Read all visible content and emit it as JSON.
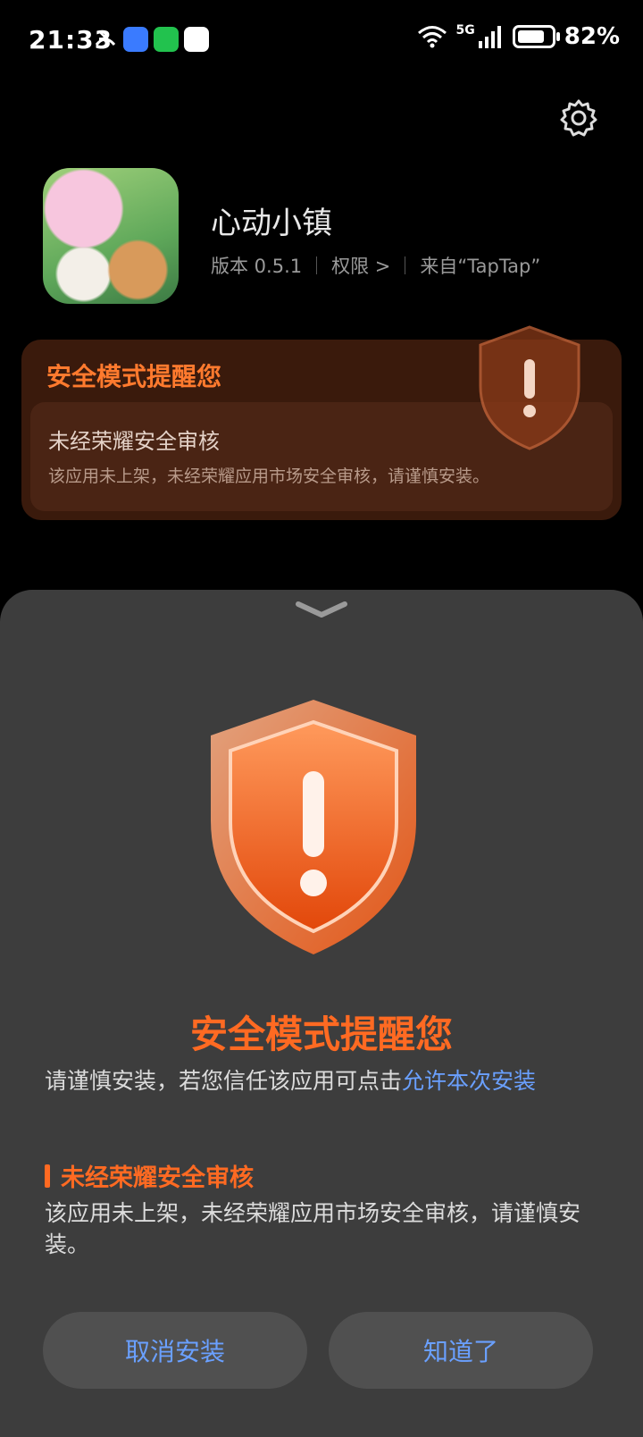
{
  "status_bar": {
    "time": "21:33",
    "signal": "5G",
    "battery": "82%",
    "battery_level": 0.82,
    "notification_icons": [
      "missed-call-icon",
      "app-market-icon",
      "wechat-icon",
      "pen-app-icon"
    ]
  },
  "app": {
    "name": "心动小镇",
    "version": "版本 0.5.1",
    "permissions": "权限 >",
    "source": "来自“TapTap”"
  },
  "warning_card": {
    "title": "安全模式提醒您",
    "subtitle": "未经荣耀安全审核",
    "description": "该应用未上架，未经荣耀应用市场安全审核，请谨慎安装。"
  },
  "sheet": {
    "title": "安全模式提醒您",
    "description_prefix": "请谨慎安装，若您信任该应用可点击",
    "description_link": "允许本次安装",
    "reason_title": "未经荣耀安全审核",
    "reason_description": "该应用未上架，未经荣耀应用市场安全审核，请谨慎安装。",
    "cancel_button": "取消安装",
    "ok_button": "知道了"
  },
  "colors": {
    "accent_orange": "#ff6a22",
    "link_blue": "#6aa0ff",
    "sheet_background": "#3d3d3d"
  }
}
